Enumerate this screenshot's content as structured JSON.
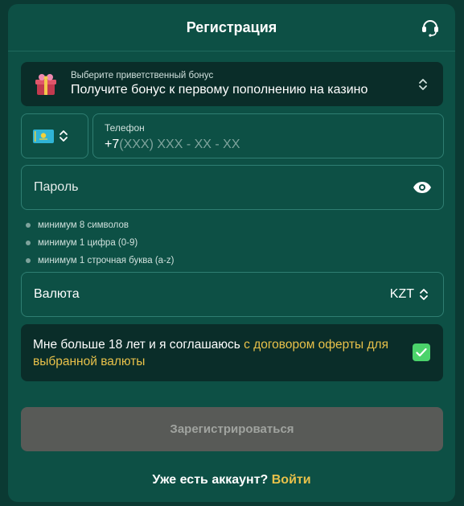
{
  "header": {
    "title": "Регистрация",
    "support_icon": "headset-icon"
  },
  "bonus": {
    "hint": "Выберите приветственный бонус",
    "value": "Получите бонус к первому пополнению на казино",
    "icon": "gift-icon"
  },
  "phone": {
    "country_flag": "kazakhstan-flag-icon",
    "label": "Телефон",
    "prefix": "+7",
    "mask": "(XXX) XXX - XX - XX"
  },
  "password": {
    "placeholder": "Пароль",
    "icon": "eye-icon"
  },
  "password_rules": [
    "минимум 8 символов",
    "минимум 1 цифра (0-9)",
    "минимум 1 строчная буква (a-z)"
  ],
  "currency": {
    "label": "Валюта",
    "value": "KZT"
  },
  "agreement": {
    "text": "Мне больше 18 лет и я соглашаюсь ",
    "link": "с договором оферты для выбранной валюты",
    "checked": true
  },
  "submit_label": "Зарегистрироваться",
  "footer": {
    "text": "Уже есть аккаунт?",
    "link": "Войти"
  },
  "colors": {
    "background": "#0d5045",
    "panel": "#0a2d29",
    "accent": "#e8c14a",
    "checkbox": "#4bd36b",
    "disabled_button": "#585a57"
  }
}
